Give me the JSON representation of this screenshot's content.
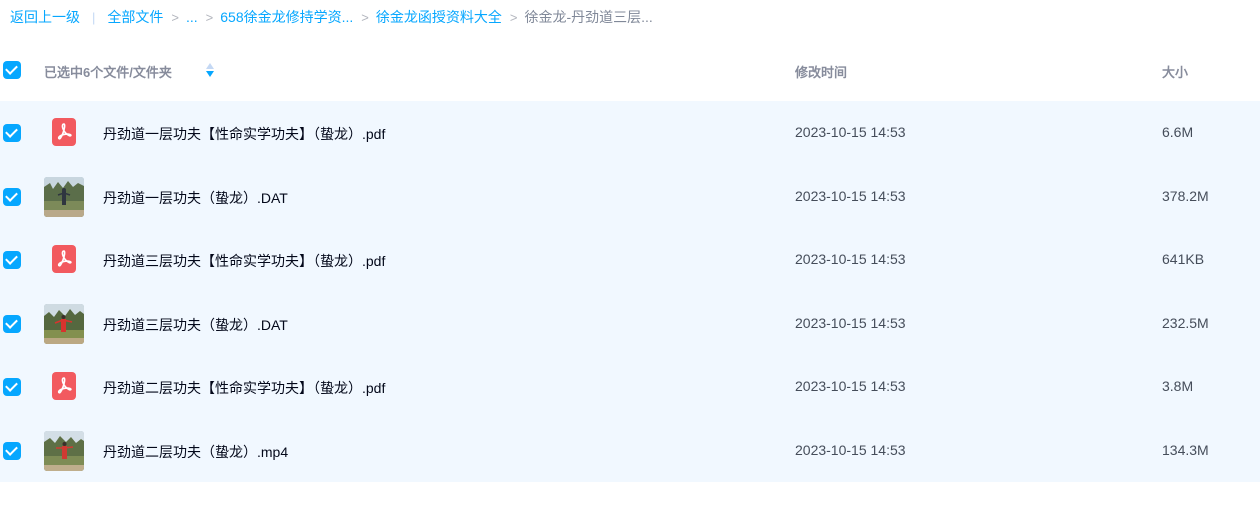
{
  "breadcrumb": {
    "back": "返回上一级",
    "divider": "|",
    "items": [
      "全部文件",
      "...",
      "658徐金龙修持学资...",
      "徐金龙函授资料大全"
    ],
    "separator": ">",
    "current": "徐金龙-丹劲道三层..."
  },
  "header": {
    "selected_label": "已选中6个文件/文件夹",
    "time_label": "修改时间",
    "size_label": "大小"
  },
  "files": [
    {
      "name": "丹劲道一层功夫【性命实学功夫】（蛰龙）.pdf",
      "time": "2023-10-15 14:53",
      "size": "6.6M",
      "icon": "pdf-icon"
    },
    {
      "name": "丹劲道一层功夫（蛰龙）.DAT",
      "time": "2023-10-15 14:53",
      "size": "378.2M",
      "icon": "video-thumbnail"
    },
    {
      "name": "丹劲道三层功夫【性命实学功夫】（蛰龙）.pdf",
      "time": "2023-10-15 14:53",
      "size": "641KB",
      "icon": "pdf-icon"
    },
    {
      "name": "丹劲道三层功夫（蛰龙）.DAT",
      "time": "2023-10-15 14:53",
      "size": "232.5M",
      "icon": "video-thumbnail"
    },
    {
      "name": "丹劲道二层功夫【性命实学功夫】（蛰龙）.pdf",
      "time": "2023-10-15 14:53",
      "size": "3.8M",
      "icon": "pdf-icon"
    },
    {
      "name": "丹劲道二层功夫（蛰龙）.mp4",
      "time": "2023-10-15 14:53",
      "size": "134.3M",
      "icon": "video-thumbnail"
    }
  ],
  "colors": {
    "accent": "#06a7ff",
    "row_selected_bg": "#f1f8ff",
    "pdf_red": "#f25a5f"
  }
}
